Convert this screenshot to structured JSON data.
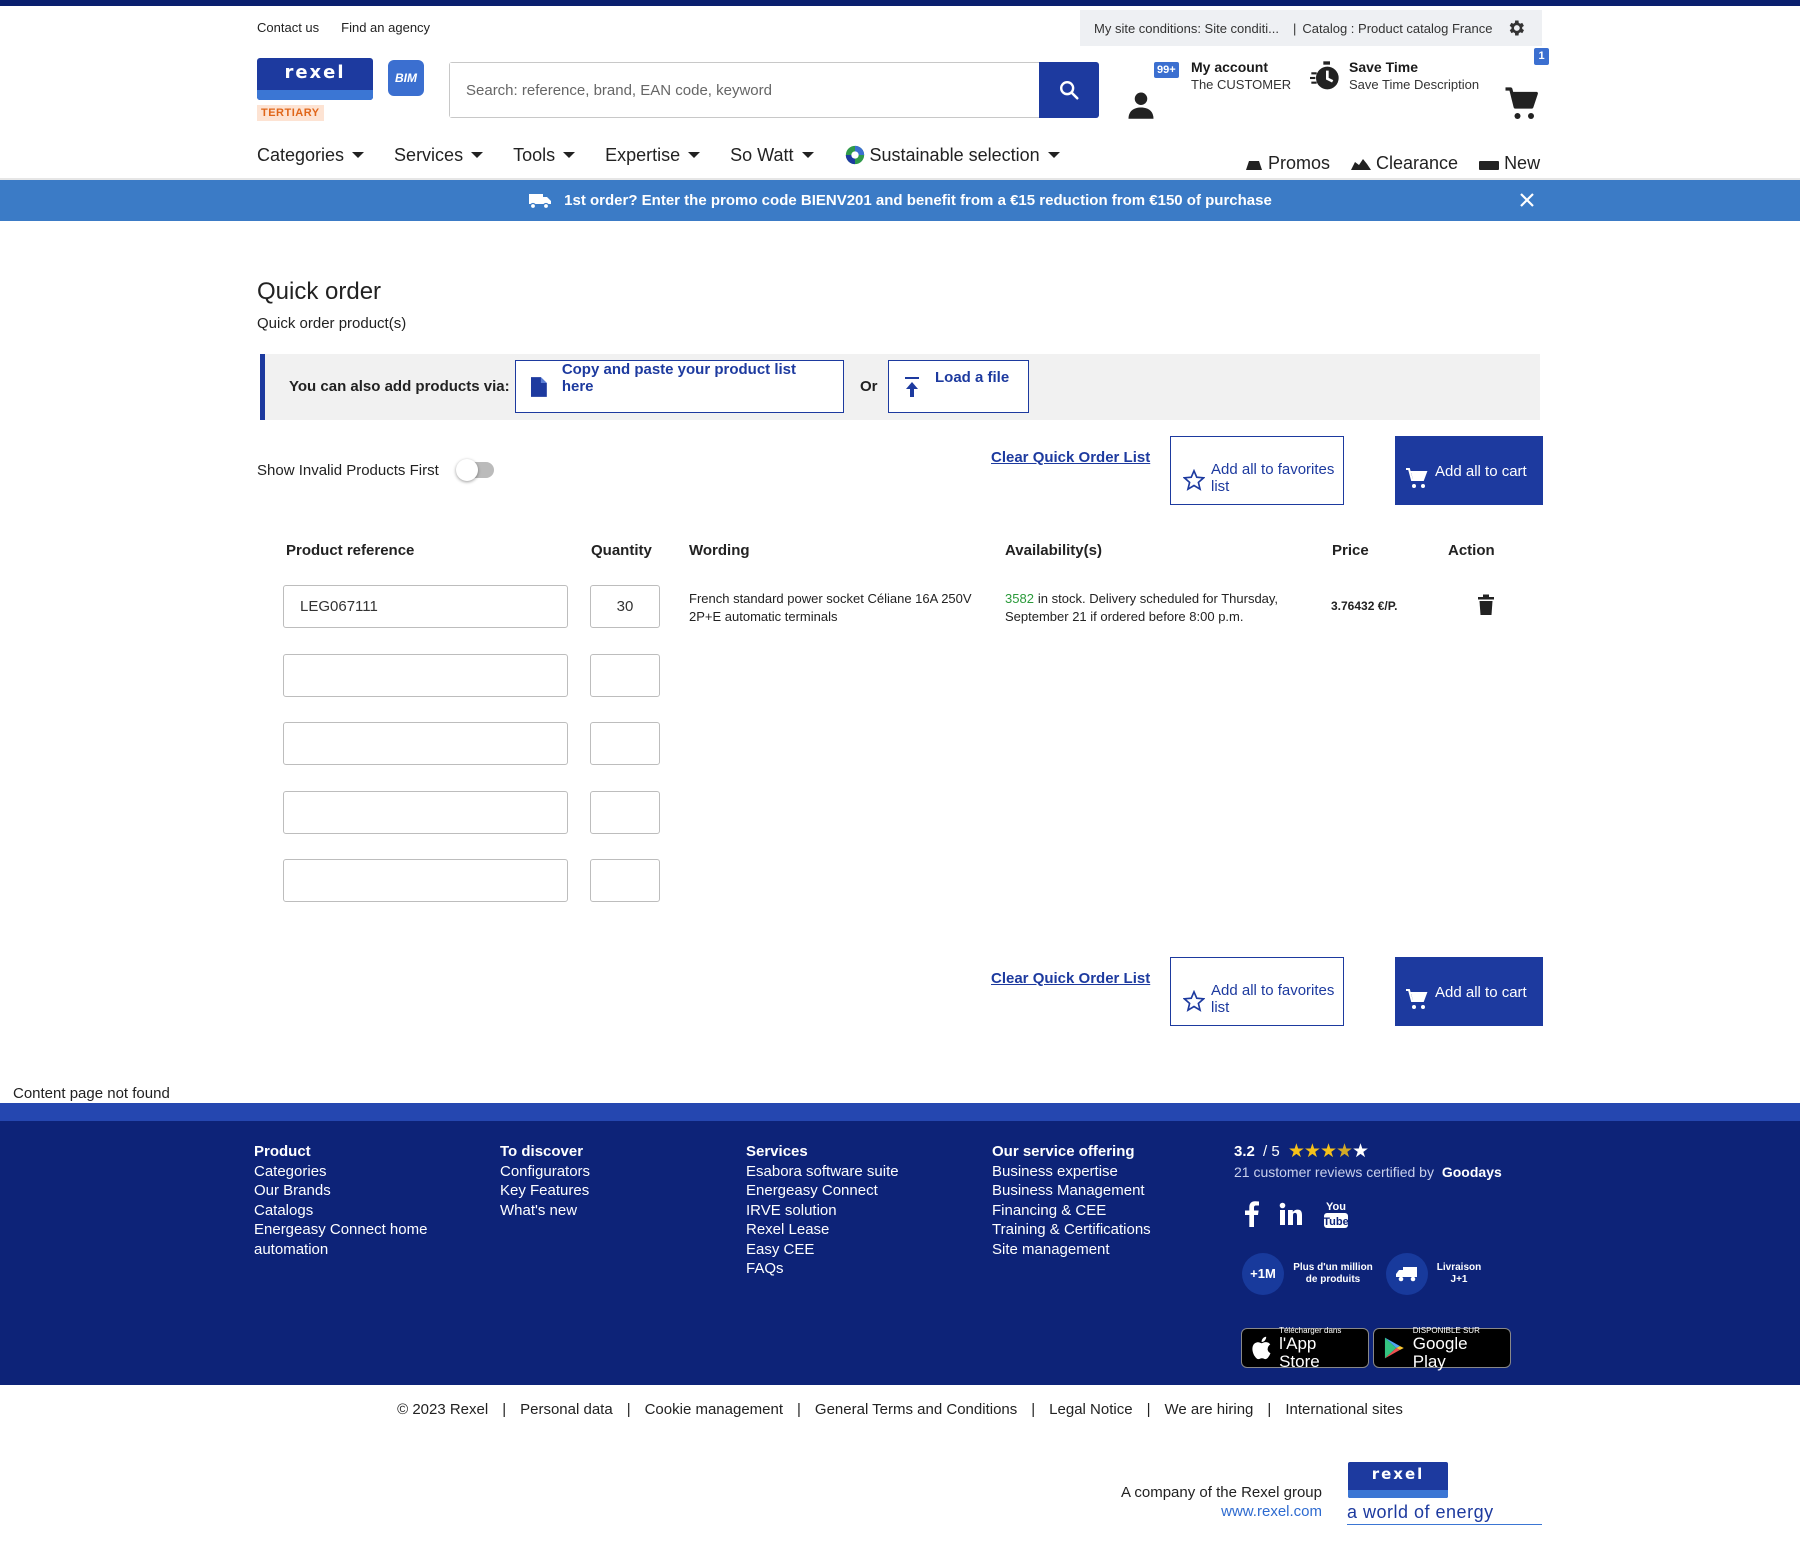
{
  "header": {
    "links": [
      "Contact us",
      "Find an agency"
    ],
    "site_conditions": "My site conditions: Site conditi...",
    "catalog": "Catalog : Product catalog France",
    "logo_text": "rexel",
    "segment_badge": "TERTIARY",
    "bim_label": "BIM",
    "search_placeholder": "Search: reference, brand, EAN code, keyword",
    "account_badge": "99+",
    "account_title": "My account",
    "account_sub": "The CUSTOMER",
    "savetime_title": "Save Time",
    "savetime_sub": "Save Time Description",
    "cart_count": "1"
  },
  "nav": {
    "items": [
      "Categories",
      "Services",
      "Tools",
      "Expertise",
      "So Watt",
      "Sustainable selection"
    ],
    "right_items": [
      "Promos",
      "Clearance",
      "New"
    ]
  },
  "promo_banner": "1st order? Enter the promo code BIENV201 and benefit from a €15 reduction from €150 of purchase",
  "page": {
    "title": "Quick order",
    "subtitle": "Quick order product(s)",
    "add_via_label": "You can also add products via:",
    "copy_paste_label": "Copy and paste your product list here",
    "or_label": "Or",
    "load_file_label": "Load a file",
    "toggle_label": "Show Invalid Products First",
    "toggle_on": false,
    "clear_label": "Clear Quick Order List",
    "favorites_label": "Add all to favorites list",
    "cart_label": "Add all to cart"
  },
  "table": {
    "headers": [
      "Product reference",
      "Quantity",
      "Wording",
      "Availability(s)",
      "Price",
      "Action"
    ],
    "rows": [
      {
        "reference": "LEG067111",
        "quantity": "30",
        "wording": "French standard power socket Céliane 16A 250V 2P+E automatic terminals",
        "stock": "3582",
        "availability": "in stock. Delivery scheduled for Thursday, September 21 if ordered before 8:00 p.m.",
        "price": "3.76432 €/P."
      },
      {
        "reference": "",
        "quantity": ""
      },
      {
        "reference": "",
        "quantity": ""
      },
      {
        "reference": "",
        "quantity": ""
      },
      {
        "reference": "",
        "quantity": ""
      }
    ]
  },
  "content_not_found": "Content page not found",
  "footer": {
    "columns": [
      {
        "title": "Product",
        "links": [
          "Categories",
          "Our Brands",
          "Catalogs",
          "Energeasy Connect home automation"
        ]
      },
      {
        "title": "To discover",
        "links": [
          "Configurators",
          "Key Features",
          "What's new"
        ]
      },
      {
        "title": "Services",
        "links": [
          "Esabora software suite",
          "Energeasy Connect",
          "IRVE solution",
          "Rexel Lease",
          "Easy CEE",
          "FAQs"
        ]
      },
      {
        "title": "Our service offering",
        "links": [
          "Business expertise",
          "Business Management",
          "Financing & CEE",
          "Training & Certifications",
          "Site management"
        ]
      }
    ],
    "rating": "3.2",
    "rating_max": "/ 5",
    "rating_stars_filled": 3.5,
    "reviews_text": "21 customer reviews certified by",
    "reviews_brand": "Goodays",
    "badge1_circle": "+1M",
    "badge1_text": "Plus d'un million de produits",
    "badge2_text": "Livraison J+1",
    "appstore_small": "Télécharger dans",
    "appstore_big": "l'App Store",
    "googleplay_small": "DISPONIBLE SUR",
    "googleplay_big": "Google Play"
  },
  "bottom": {
    "copyright": "©  2023 Rexel",
    "links": [
      "Personal data",
      "Cookie management",
      "General Terms and Conditions",
      "Legal Notice",
      "We are hiring",
      "International sites"
    ],
    "company_line": "A company of the Rexel group",
    "company_url": "www.rexel.com",
    "logo_text": "rexel",
    "tagline": "a world of energy"
  },
  "colors": {
    "brand_blue": "#1d3a9f",
    "promo_blue": "#3b7bc6",
    "footer_blue": "#0d2378",
    "stock_green": "#2a9a3a"
  }
}
